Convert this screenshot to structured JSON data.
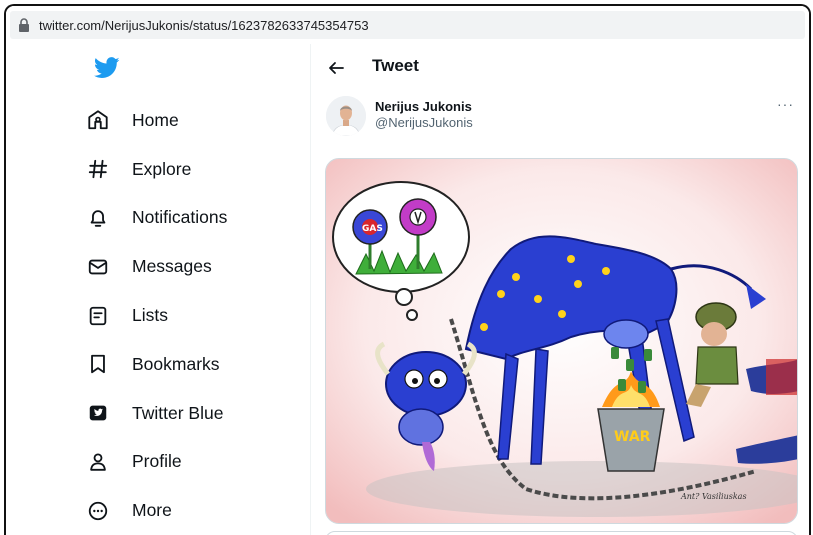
{
  "browser": {
    "url": "twitter.com/NerijusJukonis/status/1623782633745354753"
  },
  "sidebar": {
    "logo_icon": "twitter-bird-icon",
    "items": [
      {
        "label": "Home",
        "icon": "home-icon"
      },
      {
        "label": "Explore",
        "icon": "hashtag-icon"
      },
      {
        "label": "Notifications",
        "icon": "bell-icon"
      },
      {
        "label": "Messages",
        "icon": "envelope-icon"
      },
      {
        "label": "Lists",
        "icon": "list-icon"
      },
      {
        "label": "Bookmarks",
        "icon": "bookmark-icon"
      },
      {
        "label": "Twitter Blue",
        "icon": "twitter-blue-icon"
      },
      {
        "label": "Profile",
        "icon": "person-icon"
      },
      {
        "label": "More",
        "icon": "more-circle-icon"
      }
    ]
  },
  "header": {
    "back_icon": "arrow-left-icon",
    "title": "Tweet"
  },
  "tweet": {
    "author_name": "Nerijus Jukonis",
    "author_handle": "@NerijusJukonis",
    "menu_icon": "more-horizontal-icon",
    "menu_glyph": "···"
  },
  "cartoon": {
    "bubble_text": "GAS",
    "bucket_text": "WAR",
    "signature": "Ant? Vasiliuskas"
  },
  "colors": {
    "brand": "#1d9bf0",
    "text": "#0f1419",
    "secondary": "#536471",
    "border": "#cfd9de",
    "eu_blue": "#2a3fd1",
    "eu_star": "#ffd21a"
  }
}
